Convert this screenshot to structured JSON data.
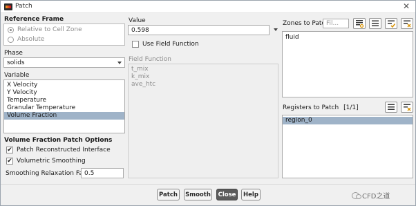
{
  "window": {
    "title": "Patch",
    "close_glyph": "✕"
  },
  "reference_frame": {
    "title": "Reference Frame",
    "options": [
      {
        "label": "Relative to Cell Zone",
        "selected": true
      },
      {
        "label": "Absolute",
        "selected": false
      }
    ]
  },
  "phase": {
    "label": "Phase",
    "value": "solids"
  },
  "variable": {
    "label": "Variable",
    "items": [
      "X Velocity",
      "Y Velocity",
      "Temperature",
      "Granular Temperature",
      "Volume Fraction"
    ],
    "selected": "Volume Fraction"
  },
  "vf_options": {
    "title": "Volume Fraction Patch Options",
    "patch_reconstructed": {
      "label": "Patch Reconstructed Interface",
      "checked": true
    },
    "volumetric_smoothing": {
      "label": "Volumetric Smoothing",
      "checked": true
    },
    "relaxation": {
      "label": "Smoothing Relaxation Factor",
      "value": "0.5"
    }
  },
  "value": {
    "label": "Value",
    "value": "0.598"
  },
  "use_field_function": {
    "label": "Use Field Function",
    "checked": false
  },
  "field_function": {
    "label": "Field Function",
    "items": [
      "t_mix",
      "k_mix",
      "ave_htc"
    ]
  },
  "zones": {
    "label": "Zones to Patch",
    "filter_placeholder": "Fil...",
    "items": [
      "fluid"
    ]
  },
  "registers": {
    "label": "Registers to Patch",
    "count": "[1/1]",
    "items": [
      "region_0"
    ]
  },
  "buttons": {
    "patch": "Patch",
    "smooth": "Smooth",
    "close": "Close",
    "help": "Help"
  },
  "watermark": {
    "text": "CFD之道"
  },
  "colors": {
    "selection": "#9fb3c8",
    "close_button": "#5b5b5b"
  }
}
